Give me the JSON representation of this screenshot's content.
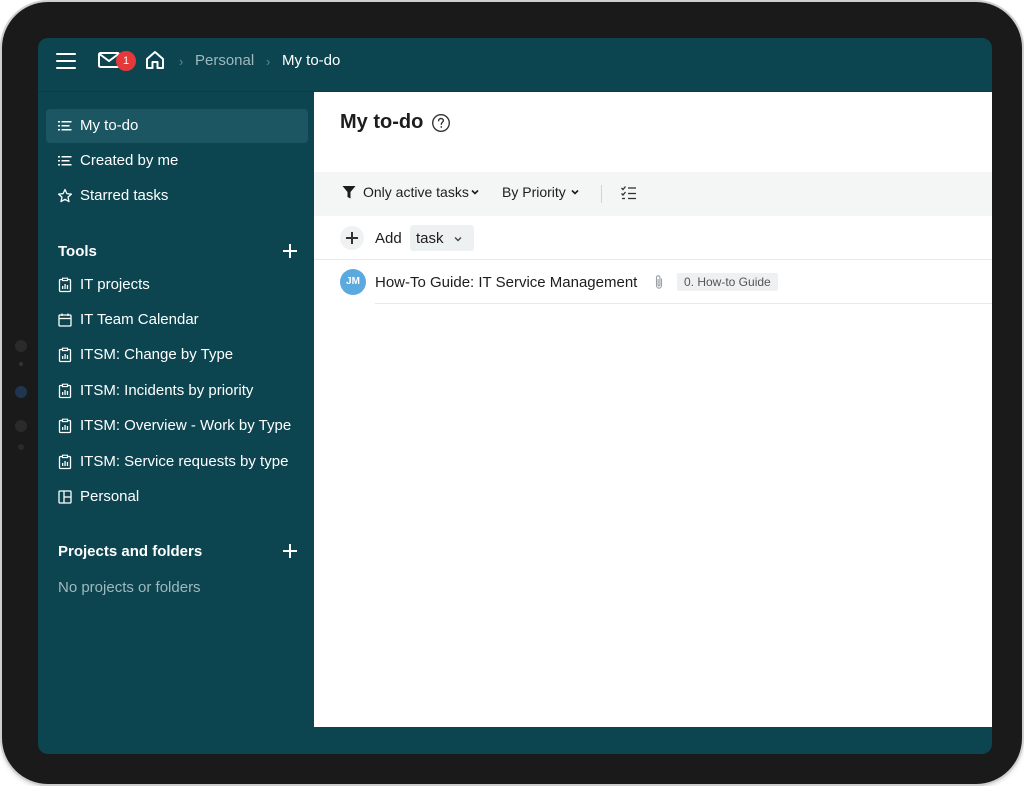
{
  "header": {
    "menu_icon": "hamburger-icon",
    "mail_icon": "mail-icon",
    "mail_badge_count": "1",
    "home_icon": "home-icon",
    "breadcrumb": {
      "parent": "Personal",
      "current": "My to-do"
    }
  },
  "sidebar": {
    "items": [
      {
        "label": "My to-do",
        "icon": "list-icon",
        "active": true
      },
      {
        "label": "Created by me",
        "icon": "list-icon"
      },
      {
        "label": "Starred tasks",
        "icon": "star-icon"
      }
    ],
    "tools": {
      "heading": "Tools",
      "items": [
        {
          "label": "IT projects",
          "icon": "report-icon"
        },
        {
          "label": "IT Team Calendar",
          "icon": "calendar-icon"
        },
        {
          "label": "ITSM: Change by Type",
          "icon": "report-icon"
        },
        {
          "label": "ITSM: Incidents by priority",
          "icon": "report-icon"
        },
        {
          "label": "ITSM: Overview - Work by Type",
          "icon": "report-icon"
        },
        {
          "label": "ITSM: Service requests by type",
          "icon": "report-icon"
        },
        {
          "label": "Personal",
          "icon": "board-icon"
        }
      ]
    },
    "projects": {
      "heading": "Projects and folders",
      "empty_text": "No projects or folders"
    }
  },
  "main": {
    "title": "My to-do",
    "toolbar": {
      "filter_label": "Only active tasks",
      "sort_label": "By Priority"
    },
    "add_row": {
      "label": "Add",
      "type_value": "task"
    },
    "tasks": [
      {
        "assignee_initials": "JM",
        "title": "How-To Guide: IT Service Management",
        "has_attachment": true,
        "tag": "0. How-to Guide"
      }
    ]
  },
  "colors": {
    "sidebar_bg": "#0c4550",
    "active_item_bg": "#1c5663",
    "badge": "#e5383b",
    "avatar": "#5aa9df"
  }
}
